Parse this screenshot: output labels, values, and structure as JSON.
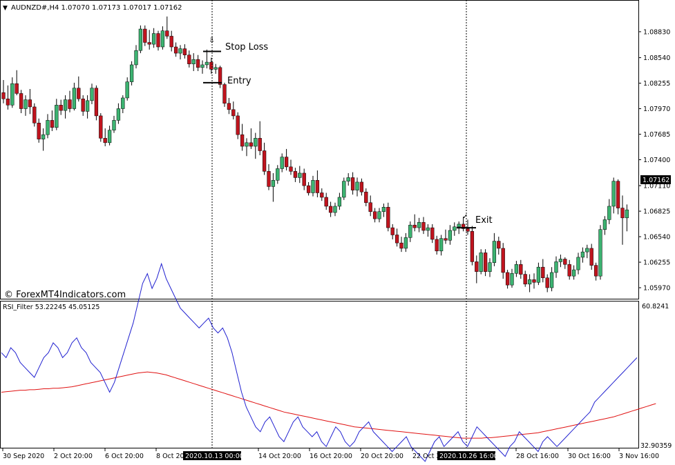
{
  "header": {
    "menu_icon": "triangle-down-icon",
    "symbol_label": "AUDNZD#,H4  1.07070 1.07173 1.07017 1.07162"
  },
  "price_axis": {
    "ticks": [
      "1.08830",
      "1.08540",
      "1.08255",
      "1.07970",
      "1.07685",
      "1.07400",
      "1.07110",
      "1.06825",
      "1.06540",
      "1.06255",
      "1.05970"
    ],
    "current_price": "1.07162"
  },
  "annotations": {
    "stop_loss": "Stop Loss",
    "entry": "Entry",
    "exit": "Exit",
    "stop_marker_icon": "arrow-down-outline-icon",
    "exit_marker_icon": "check-mark-icon"
  },
  "watermark": "© ForexMT4Indicators.com",
  "indicator": {
    "label": "RSI_Filter 53.22245 45.05125",
    "max": "60.8241",
    "min": "32.90359"
  },
  "time_axis": {
    "ticks": [
      "30 Sep 2020",
      "2 Oct 20:00",
      "6 Oct 20:00",
      "8 Oct 20:00",
      "14 Oct 20:00",
      "16 Oct 20:00",
      "20 Oct 20:00",
      "22 Oct 20:00",
      "28 Oct 16:00",
      "30 Oct 16:00",
      "3 Nov 16:00"
    ],
    "highlights": [
      "2020.10.13 00:00",
      "2020.10.26 16:00"
    ]
  },
  "colors": {
    "bull": "#3cb371",
    "bear": "#c0141e",
    "rsi_line": "#2020d0",
    "signal_line": "#e01010",
    "highlight_bg": "#000000",
    "highlight_fg": "#ffffff"
  },
  "chart_data": {
    "type": "candlestick",
    "ylim": [
      1.0587,
      1.0903
    ],
    "candles": [
      [
        1.0815,
        1.0829,
        1.0803,
        1.0808
      ],
      [
        1.0808,
        1.0823,
        1.0796,
        1.0801
      ],
      [
        1.0801,
        1.0832,
        1.0798,
        1.0825
      ],
      [
        1.0825,
        1.084,
        1.0812,
        1.0814
      ],
      [
        1.0814,
        1.0818,
        1.0792,
        1.0797
      ],
      [
        1.0797,
        1.0812,
        1.0789,
        1.0807
      ],
      [
        1.0807,
        1.0819,
        1.0791,
        1.0799
      ],
      [
        1.0799,
        1.0803,
        1.0777,
        1.0781
      ],
      [
        1.0781,
        1.0786,
        1.0759,
        1.0763
      ],
      [
        1.0763,
        1.0775,
        1.075,
        1.0768
      ],
      [
        1.0768,
        1.0791,
        1.0764,
        1.0784
      ],
      [
        1.0784,
        1.0795,
        1.0772,
        1.0776
      ],
      [
        1.0776,
        1.0808,
        1.0773,
        1.0801
      ],
      [
        1.0801,
        1.0807,
        1.079,
        1.0795
      ],
      [
        1.0795,
        1.0812,
        1.0786,
        1.0807
      ],
      [
        1.0807,
        1.0817,
        1.0793,
        1.0797
      ],
      [
        1.0797,
        1.0826,
        1.0795,
        1.082
      ],
      [
        1.082,
        1.0833,
        1.0805,
        1.0808
      ],
      [
        1.0808,
        1.0812,
        1.0789,
        1.0794
      ],
      [
        1.0794,
        1.0812,
        1.0786,
        1.0806
      ],
      [
        1.0806,
        1.0825,
        1.0802,
        1.082
      ],
      [
        1.082,
        1.0823,
        1.0784,
        1.0789
      ],
      [
        1.0789,
        1.0792,
        1.076,
        1.0764
      ],
      [
        1.0764,
        1.0775,
        1.0755,
        1.0759
      ],
      [
        1.0759,
        1.0778,
        1.0756,
        1.0773
      ],
      [
        1.0773,
        1.0789,
        1.077,
        1.0784
      ],
      [
        1.0784,
        1.0803,
        1.078,
        1.0797
      ],
      [
        1.0797,
        1.0812,
        1.0792,
        1.0809
      ],
      [
        1.0809,
        1.0832,
        1.0806,
        1.0827
      ],
      [
        1.0827,
        1.085,
        1.0823,
        1.0846
      ],
      [
        1.0846,
        1.0868,
        1.0842,
        1.0862
      ],
      [
        1.0862,
        1.089,
        1.0859,
        1.0886
      ],
      [
        1.0886,
        1.089,
        1.0867,
        1.0871
      ],
      [
        1.0871,
        1.0885,
        1.0863,
        1.0869
      ],
      [
        1.0869,
        1.0887,
        1.0865,
        1.0881
      ],
      [
        1.0881,
        1.0884,
        1.0862,
        1.0866
      ],
      [
        1.0866,
        1.0889,
        1.0863,
        1.0884
      ],
      [
        1.0884,
        1.09,
        1.0875,
        1.0878
      ],
      [
        1.0878,
        1.0884,
        1.0861,
        1.0866
      ],
      [
        1.0866,
        1.0871,
        1.0855,
        1.0859
      ],
      [
        1.0859,
        1.0868,
        1.0852,
        1.0864
      ],
      [
        1.0864,
        1.0869,
        1.0853,
        1.0857
      ],
      [
        1.0857,
        1.0862,
        1.0843,
        1.0847
      ],
      [
        1.0847,
        1.0859,
        1.0839,
        1.0852
      ],
      [
        1.0852,
        1.0857,
        1.0839,
        1.0843
      ],
      [
        1.0843,
        1.0851,
        1.0836,
        1.0846
      ],
      [
        1.0846,
        1.0863,
        1.0842,
        1.0849
      ],
      [
        1.0849,
        1.0854,
        1.0836,
        1.0841
      ],
      [
        1.0841,
        1.0847,
        1.0836,
        1.0843
      ],
      [
        1.0843,
        1.0845,
        1.082,
        1.0824
      ],
      [
        1.0824,
        1.0826,
        1.0799,
        1.0803
      ],
      [
        1.0803,
        1.0809,
        1.0791,
        1.0796
      ],
      [
        1.0796,
        1.0805,
        1.0785,
        1.0789
      ],
      [
        1.0789,
        1.0793,
        1.0763,
        1.0768
      ],
      [
        1.0768,
        1.078,
        1.075,
        1.0755
      ],
      [
        1.0755,
        1.0764,
        1.0744,
        1.0759
      ],
      [
        1.0759,
        1.0775,
        1.0752,
        1.0755
      ],
      [
        1.0755,
        1.077,
        1.0741,
        1.0764
      ],
      [
        1.0764,
        1.0783,
        1.0745,
        1.075
      ],
      [
        1.075,
        1.0759,
        1.0723,
        1.0727
      ],
      [
        1.0727,
        1.0735,
        1.0706,
        1.071
      ],
      [
        1.071,
        1.0725,
        1.0693,
        1.0717
      ],
      [
        1.0717,
        1.0734,
        1.0713,
        1.073
      ],
      [
        1.073,
        1.0747,
        1.0726,
        1.0743
      ],
      [
        1.0743,
        1.0752,
        1.0728,
        1.0732
      ],
      [
        1.0732,
        1.074,
        1.0723,
        1.0727
      ],
      [
        1.0727,
        1.0731,
        1.0715,
        1.072
      ],
      [
        1.072,
        1.0733,
        1.0714,
        1.0725
      ],
      [
        1.0725,
        1.073,
        1.0706,
        1.0711
      ],
      [
        1.0711,
        1.0715,
        1.07,
        1.0703
      ],
      [
        1.0703,
        1.0722,
        1.0699,
        1.0717
      ],
      [
        1.0717,
        1.0728,
        1.0698,
        1.0703
      ],
      [
        1.0703,
        1.0708,
        1.0694,
        1.0698
      ],
      [
        1.0698,
        1.0703,
        1.0684,
        1.0688
      ],
      [
        1.0688,
        1.0693,
        1.0676,
        1.0681
      ],
      [
        1.0681,
        1.0692,
        1.0677,
        1.0688
      ],
      [
        1.0688,
        1.0703,
        1.0684,
        1.0698
      ],
      [
        1.0698,
        1.072,
        1.0695,
        1.0716
      ],
      [
        1.0716,
        1.0725,
        1.0711,
        1.072
      ],
      [
        1.072,
        1.0726,
        1.0701,
        1.0706
      ],
      [
        1.0706,
        1.072,
        1.0699,
        1.0715
      ],
      [
        1.0715,
        1.0719,
        1.07,
        1.0704
      ],
      [
        1.0704,
        1.0708,
        1.0688,
        1.0692
      ],
      [
        1.0692,
        1.07,
        1.0677,
        1.0682
      ],
      [
        1.0682,
        1.0686,
        1.067,
        1.0674
      ],
      [
        1.0674,
        1.0686,
        1.067,
        1.0682
      ],
      [
        1.0682,
        1.0691,
        1.0676,
        1.0687
      ],
      [
        1.0687,
        1.0692,
        1.066,
        1.0664
      ],
      [
        1.0664,
        1.0668,
        1.0651,
        1.0656
      ],
      [
        1.0656,
        1.0663,
        1.0643,
        1.0647
      ],
      [
        1.0647,
        1.0654,
        1.0637,
        1.0641
      ],
      [
        1.0641,
        1.0658,
        1.0637,
        1.0653
      ],
      [
        1.0653,
        1.0671,
        1.0648,
        1.0667
      ],
      [
        1.0667,
        1.0679,
        1.066,
        1.0664
      ],
      [
        1.0664,
        1.0675,
        1.0659,
        1.067
      ],
      [
        1.067,
        1.0676,
        1.0657,
        1.0661
      ],
      [
        1.0661,
        1.0668,
        1.0654,
        1.0664
      ],
      [
        1.0664,
        1.0668,
        1.0647,
        1.0651
      ],
      [
        1.0651,
        1.0655,
        1.0634,
        1.0638
      ],
      [
        1.0638,
        1.0656,
        1.0633,
        1.0652
      ],
      [
        1.0652,
        1.0662,
        1.0646,
        1.065
      ],
      [
        1.065,
        1.0667,
        1.0645,
        1.0661
      ],
      [
        1.0661,
        1.067,
        1.0655,
        1.0665
      ],
      [
        1.0665,
        1.0671,
        1.0657,
        1.0668
      ],
      [
        1.0668,
        1.0676,
        1.066,
        1.0663
      ],
      [
        1.0663,
        1.0673,
        1.0656,
        1.066
      ],
      [
        1.066,
        1.0666,
        1.0622,
        1.0626
      ],
      [
        1.0626,
        1.0633,
        1.0602,
        1.0615
      ],
      [
        1.0615,
        1.064,
        1.0612,
        1.0636
      ],
      [
        1.0636,
        1.064,
        1.061,
        1.0615
      ],
      [
        1.0615,
        1.063,
        1.0609,
        1.0625
      ],
      [
        1.0625,
        1.0658,
        1.0621,
        1.0649
      ],
      [
        1.0649,
        1.0654,
        1.0634,
        1.0641
      ],
      [
        1.0641,
        1.0647,
        1.0607,
        1.0614
      ],
      [
        1.0614,
        1.0617,
        1.0596,
        1.06
      ],
      [
        1.06,
        1.0618,
        1.0597,
        1.0613
      ],
      [
        1.0613,
        1.0627,
        1.0609,
        1.0623
      ],
      [
        1.0623,
        1.0628,
        1.0607,
        1.0612
      ],
      [
        1.0612,
        1.0616,
        1.0598,
        1.0601
      ],
      [
        1.0601,
        1.0612,
        1.0592,
        1.0606
      ],
      [
        1.0606,
        1.0613,
        1.0596,
        1.0603
      ],
      [
        1.0603,
        1.0625,
        1.06,
        1.062
      ],
      [
        1.062,
        1.0629,
        1.0603,
        1.0608
      ],
      [
        1.0608,
        1.0612,
        1.0592,
        1.0597
      ],
      [
        1.0597,
        1.062,
        1.0593,
        1.0614
      ],
      [
        1.0614,
        1.0632,
        1.0608,
        1.0626
      ],
      [
        1.0626,
        1.0634,
        1.062,
        1.0629
      ],
      [
        1.0629,
        1.0631,
        1.0618,
        1.0623
      ],
      [
        1.0623,
        1.0628,
        1.0606,
        1.061
      ],
      [
        1.061,
        1.0622,
        1.0606,
        1.0617
      ],
      [
        1.0617,
        1.0636,
        1.0612,
        1.0631
      ],
      [
        1.0631,
        1.0642,
        1.0625,
        1.0637
      ],
      [
        1.0637,
        1.0645,
        1.063,
        1.0641
      ],
      [
        1.0641,
        1.0646,
        1.0617,
        1.0622
      ],
      [
        1.0622,
        1.0625,
        1.0605,
        1.061
      ],
      [
        1.061,
        1.0667,
        1.0606,
        1.0662
      ],
      [
        1.0662,
        1.0677,
        1.0656,
        1.0673
      ],
      [
        1.0673,
        1.0696,
        1.0668,
        1.0688
      ],
      [
        1.0688,
        1.072,
        1.068,
        1.0716
      ],
      [
        1.0716,
        1.0718,
        1.0679,
        1.0686
      ],
      [
        1.0686,
        1.07,
        1.0645,
        1.0675
      ],
      [
        1.0675,
        1.069,
        1.066,
        1.0684
      ]
    ],
    "rsi": [
      52,
      51,
      53,
      52,
      50,
      49,
      48,
      47,
      49,
      51,
      52,
      54,
      53,
      51,
      52,
      54,
      55,
      53,
      52,
      50,
      49,
      48,
      46,
      44,
      46,
      49,
      52,
      55,
      58,
      62,
      66,
      68,
      65,
      67,
      70,
      67,
      65,
      63,
      61,
      60,
      59,
      58,
      57,
      58,
      59,
      57,
      56,
      57,
      55,
      52,
      48,
      44,
      41,
      39,
      37,
      36,
      38,
      39,
      37,
      35,
      34,
      36,
      38,
      39,
      37,
      36,
      35,
      36,
      34,
      33,
      35,
      37,
      36,
      34,
      33,
      34,
      36,
      37,
      38,
      36,
      35,
      34,
      33,
      32,
      33,
      34,
      35,
      33,
      32,
      31,
      30,
      32,
      34,
      35,
      33,
      34,
      35,
      36,
      34,
      33,
      35,
      37,
      36,
      35,
      34,
      33,
      32,
      31,
      33,
      34,
      36,
      35,
      34,
      33,
      32,
      34,
      35,
      34,
      33,
      34,
      35,
      36,
      37,
      38,
      39,
      40,
      42,
      43,
      44,
      45,
      46,
      47,
      48,
      49,
      50,
      51
    ],
    "signal": [
      44.0,
      44.1,
      44.2,
      44.3,
      44.4,
      44.4,
      44.5,
      44.5,
      44.6,
      44.7,
      44.7,
      44.8,
      44.8,
      44.9,
      45.0,
      45.1,
      45.3,
      45.5,
      45.7,
      45.9,
      46.1,
      46.3,
      46.5,
      46.7,
      46.9,
      47.1,
      47.3,
      47.5,
      47.7,
      47.9,
      48.0,
      48.1,
      48.0,
      47.9,
      47.7,
      47.5,
      47.2,
      46.9,
      46.6,
      46.3,
      46.0,
      45.7,
      45.4,
      45.1,
      44.8,
      44.5,
      44.2,
      43.9,
      43.6,
      43.3,
      43.0,
      42.7,
      42.4,
      42.1,
      41.8,
      41.5,
      41.2,
      40.9,
      40.6,
      40.3,
      40.0,
      39.8,
      39.6,
      39.4,
      39.2,
      39.0,
      38.8,
      38.6,
      38.4,
      38.2,
      38.0,
      37.8,
      37.6,
      37.4,
      37.2,
      37.0,
      36.9,
      36.8,
      36.7,
      36.6,
      36.5,
      36.4,
      36.3,
      36.2,
      36.1,
      36.0,
      35.9,
      35.8,
      35.7,
      35.6,
      35.5,
      35.4,
      35.3,
      35.2,
      35.1,
      35.0,
      34.9,
      34.8,
      34.7,
      34.7,
      34.7,
      34.7,
      34.7,
      34.8,
      34.8,
      34.9,
      35.0,
      35.1,
      35.2,
      35.3,
      35.4,
      35.5,
      35.6,
      35.7,
      35.8,
      36.0,
      36.2,
      36.4,
      36.6,
      36.8,
      37.0,
      37.2,
      37.4,
      37.6,
      37.8,
      38.0,
      38.2,
      38.4,
      38.6,
      38.8,
      39.0,
      39.3,
      39.6,
      39.9,
      40.2,
      40.5,
      40.8,
      41.1,
      41.4,
      41.7
    ],
    "rsi_ylim": [
      32.90359,
      60.8241
    ],
    "levels": {
      "stop_loss": 1.0861,
      "entry": 1.0826,
      "exit": 1.0664
    }
  }
}
